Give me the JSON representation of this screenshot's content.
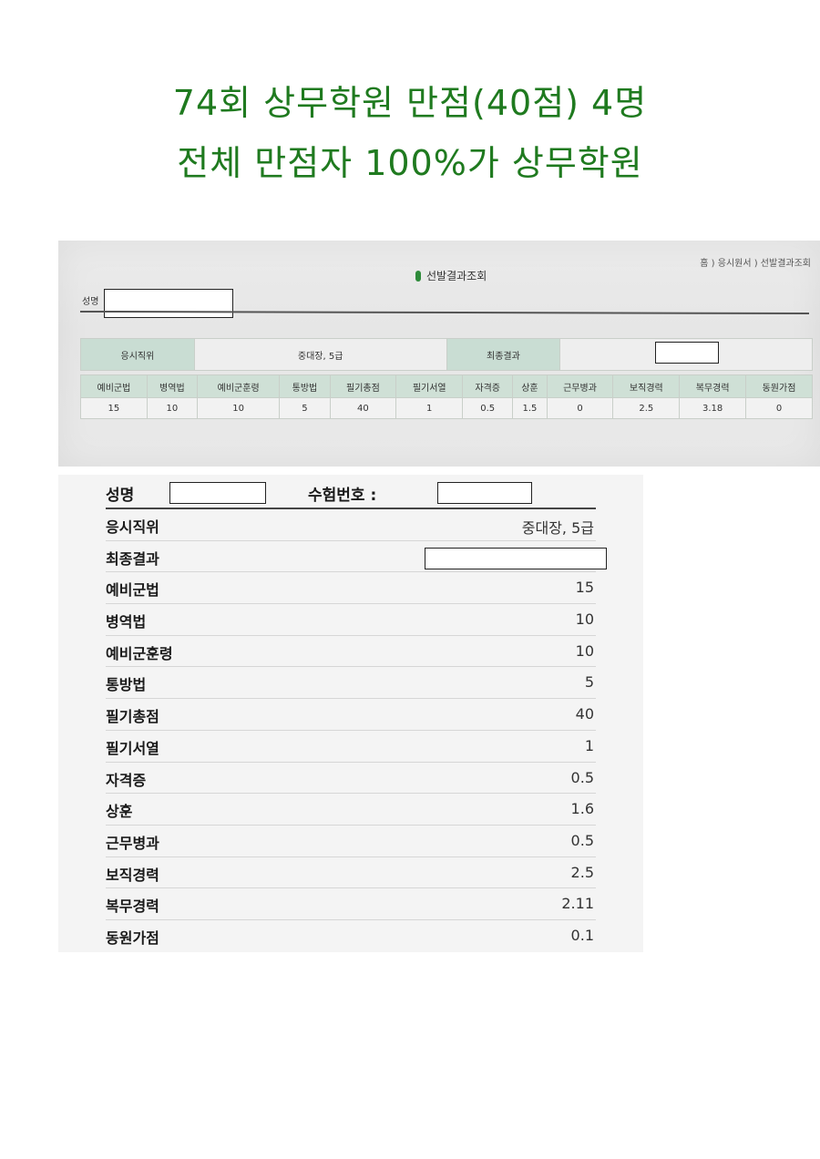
{
  "headline": {
    "line1": "74회 상무학원 만점(40점) 4명",
    "line2": "전체 만점자 100%가 상무학원"
  },
  "photo": {
    "breadcrumb": "홈 ) 응시원서 ) 선발결과조회",
    "title": "선발결과조회",
    "name_label": "성명",
    "position_label": "응시직위",
    "position_value": "중대장, 5급",
    "final_result_label": "최종결과",
    "columns": [
      "예비군법",
      "병역법",
      "예비군훈령",
      "통방법",
      "필기총점",
      "필기서열",
      "자격증",
      "상훈",
      "근무병과",
      "보직경력",
      "복무경력",
      "동원가점"
    ],
    "values": [
      "15",
      "10",
      "10",
      "5",
      "40",
      "1",
      "0.5",
      "1.5",
      "0",
      "2.5",
      "3.18",
      "0"
    ]
  },
  "panel": {
    "name_label": "성명",
    "exam_no_label": "수험번호 :",
    "rows": [
      {
        "label": "응시직위",
        "value": "중대장, 5급"
      },
      {
        "label": "최종결과",
        "value": ""
      },
      {
        "label": "예비군법",
        "value": "15"
      },
      {
        "label": "병역법",
        "value": "10"
      },
      {
        "label": "예비군훈령",
        "value": "10"
      },
      {
        "label": "통방법",
        "value": "5"
      },
      {
        "label": "필기총점",
        "value": "40"
      },
      {
        "label": "필기서열",
        "value": "1"
      },
      {
        "label": "자격증",
        "value": "0.5"
      },
      {
        "label": "상훈",
        "value": "1.6"
      },
      {
        "label": "근무병과",
        "value": "0.5"
      },
      {
        "label": "보직경력",
        "value": "2.5"
      },
      {
        "label": "복무경력",
        "value": "2.11"
      },
      {
        "label": "동원가점",
        "value": "0.1"
      }
    ]
  },
  "colors": {
    "headline": "#1f7a1f",
    "table_header": "#cfe0d6",
    "title_icon": "#2e8b3a"
  }
}
